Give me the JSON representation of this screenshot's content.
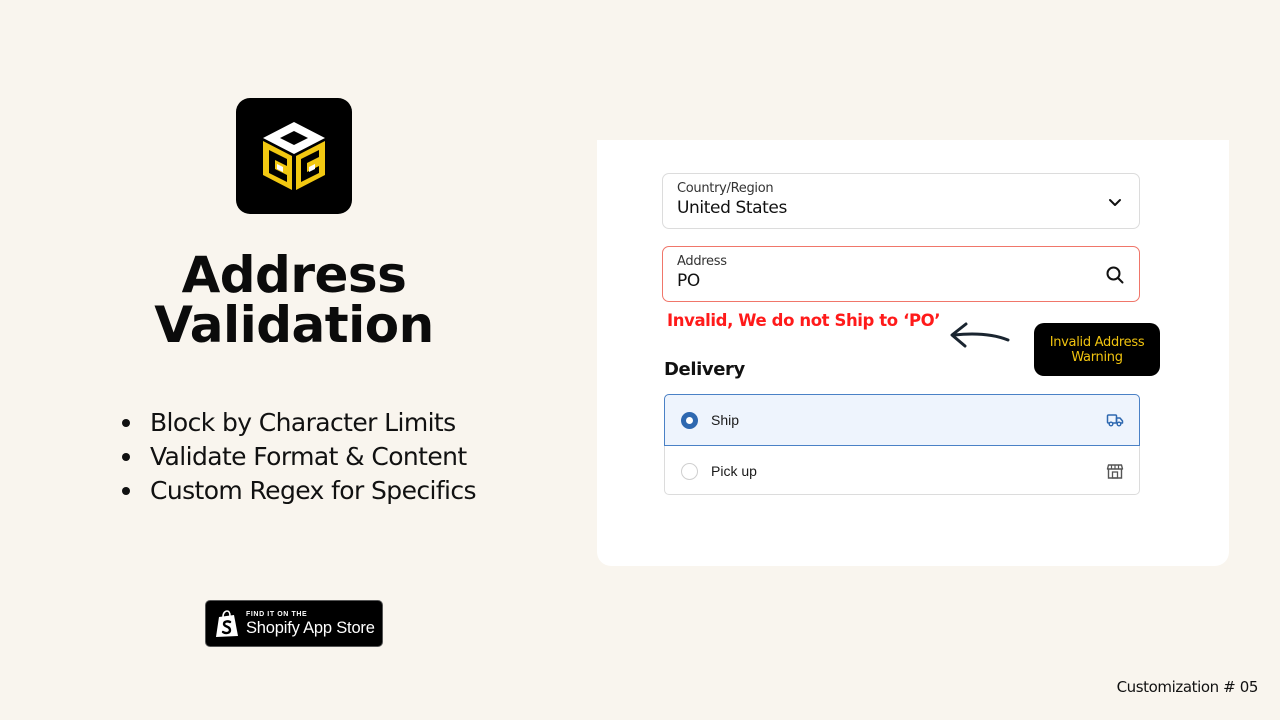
{
  "brand": {
    "logo_icon": "cube-logo-icon",
    "logo_colors": {
      "background": "#000000",
      "accent": "#f2c811",
      "white": "#ffffff"
    }
  },
  "hero": {
    "title_line1": "Address",
    "title_line2": "Validation",
    "features": [
      "Block by Character Limits",
      "Validate Format & Content",
      "Custom Regex for Specifics"
    ]
  },
  "store_badge": {
    "icon": "shopify-bag-icon",
    "small_text": "FIND IT ON THE",
    "big_text": "Shopify App Store"
  },
  "checkout_form": {
    "country": {
      "label": "Country/Region",
      "value": "United States",
      "icon": "chevron-down-icon"
    },
    "address": {
      "label": "Address",
      "value": "PO",
      "icon": "search-icon",
      "border_color": "#f0766a"
    },
    "error_message": "Invalid, We do not Ship to ‘PO’",
    "error_color": "#ff1a1a",
    "callout": {
      "icon": "arrow-left-icon",
      "text": "Invalid Address Warning",
      "text_color": "#f0c30f"
    },
    "delivery": {
      "title": "Delivery",
      "options": [
        {
          "label": "Ship",
          "selected": true,
          "icon": "truck-icon"
        },
        {
          "label": "Pick up",
          "selected": false,
          "icon": "store-icon"
        }
      ],
      "accent_color": "#2e68b0"
    }
  },
  "footer": {
    "label": "Customization # 05"
  }
}
